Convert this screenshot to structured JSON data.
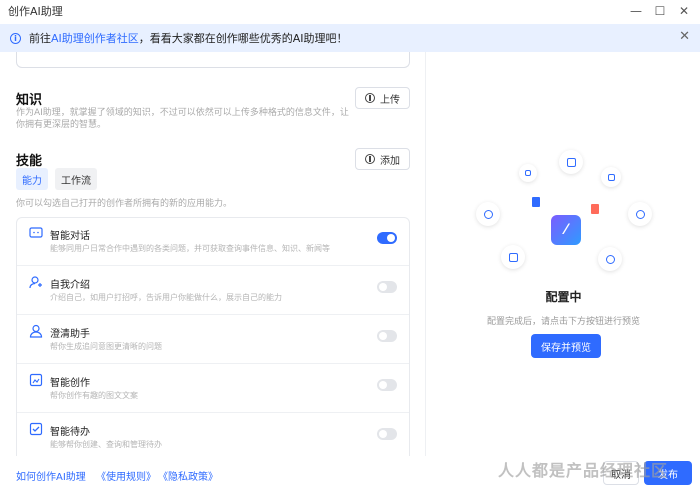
{
  "window": {
    "title": "创作AI助理",
    "min_icon": "minimize-icon",
    "max_icon": "maximize-icon",
    "close_icon": "close-icon"
  },
  "notice": {
    "prefix": "前往",
    "link": "AI助理创作者社区",
    "suffix": "，看看大家都在创作哪些优秀的AI助理吧！"
  },
  "knowledge": {
    "title": "知识",
    "desc": "作为AI助理，就掌握了领域的知识，不过可以依然可以上传多种格式的信息文件，让你拥有更深层的智慧。",
    "button": "上传"
  },
  "skills": {
    "title": "技能",
    "button": "添加",
    "tabs": [
      "能力",
      "工作流"
    ],
    "desc": "你可以勾选自己打开的创作者所拥有的新的应用能力。",
    "items": [
      {
        "name": "智能对话",
        "desc": "能够同用户日常合作中遇到的各类问题，并可获取查询事件信息、知识、新闻等",
        "on": true,
        "icon": "chat-icon"
      },
      {
        "name": "自我介绍",
        "desc": "介绍自己，如用户打招呼，告诉用户你能做什么，展示自己的能力",
        "on": false,
        "icon": "user-intro-icon"
      },
      {
        "name": "澄清助手",
        "desc": "帮你生成追问意图更清晰的问题",
        "on": false,
        "icon": "assistant-icon"
      },
      {
        "name": "智能创作",
        "desc": "帮你创作有趣的图文文案",
        "on": false,
        "icon": "create-icon"
      },
      {
        "name": "智能待办",
        "desc": "能够帮你创建、查询和管理待办",
        "on": false,
        "icon": "todo-icon"
      }
    ]
  },
  "preview": {
    "title": "配置中",
    "desc": "配置完成后，请点击下方按钮进行预览",
    "button": "保存并预览"
  },
  "footer": {
    "link1": "如何创作AI助理",
    "link2": "《使用规则》",
    "link3": "《隐私政策》",
    "cancel": "取消",
    "confirm": "发布"
  },
  "watermark": "人人都是产品经理社区"
}
